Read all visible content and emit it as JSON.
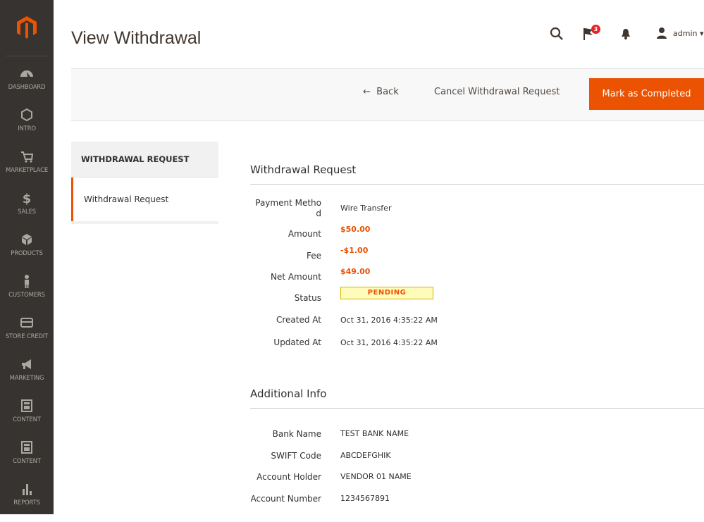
{
  "page": {
    "title": "View Withdrawal"
  },
  "header": {
    "notification_count": "3",
    "user": "admin"
  },
  "sidebar": {
    "items": [
      {
        "label": "DASHBOARD",
        "icon": "dashboard-icon"
      },
      {
        "label": "INTRO",
        "icon": "hexagon-icon"
      },
      {
        "label": "MARKETPLACE",
        "icon": "cart-icon"
      },
      {
        "label": "SALES",
        "icon": "dollar-icon"
      },
      {
        "label": "PRODUCTS",
        "icon": "box-icon"
      },
      {
        "label": "CUSTOMERS",
        "icon": "person-icon"
      },
      {
        "label": "STORE CREDIT",
        "icon": "card-icon"
      },
      {
        "label": "MARKETING",
        "icon": "megaphone-icon"
      },
      {
        "label": "CONTENT",
        "icon": "layout-icon"
      },
      {
        "label": "CONTENT",
        "icon": "layout-icon"
      },
      {
        "label": "REPORTS",
        "icon": "bar-chart-icon"
      }
    ]
  },
  "actions": {
    "back": "Back",
    "cancel": "Cancel Withdrawal Request",
    "complete": "Mark as Completed"
  },
  "tabs": {
    "heading": "WITHDRAWAL REQUEST",
    "items": [
      "Withdrawal Request"
    ]
  },
  "withdrawal": {
    "title": "Withdrawal Request",
    "payment_method_label_1": "Payment Metho",
    "payment_method_label_2": "d",
    "payment_method": "Wire Transfer",
    "amount_label": "Amount",
    "amount": "$50.00",
    "fee_label": "Fee",
    "fee": "-$1.00",
    "net_label": "Net Amount",
    "net": "$49.00",
    "status_label": "Status",
    "status": "PENDING",
    "created_label": "Created At",
    "created": "Oct 31, 2016 4:35:22 AM",
    "updated_label": "Updated At",
    "updated": "Oct 31, 2016 4:35:22 AM"
  },
  "additional": {
    "title": "Additional Info",
    "bank_label": "Bank Name",
    "bank": "TEST BANK NAME",
    "swift_label": "SWIFT Code",
    "swift": "ABCDEFGHIK",
    "holder_label": "Account Holder",
    "holder": "VENDOR 01 NAME",
    "number_label": "Account Number",
    "number": "1234567891"
  },
  "colors": {
    "accent": "#eb5202",
    "sidebar": "#373330",
    "pending_bg": "#fffbbb"
  }
}
